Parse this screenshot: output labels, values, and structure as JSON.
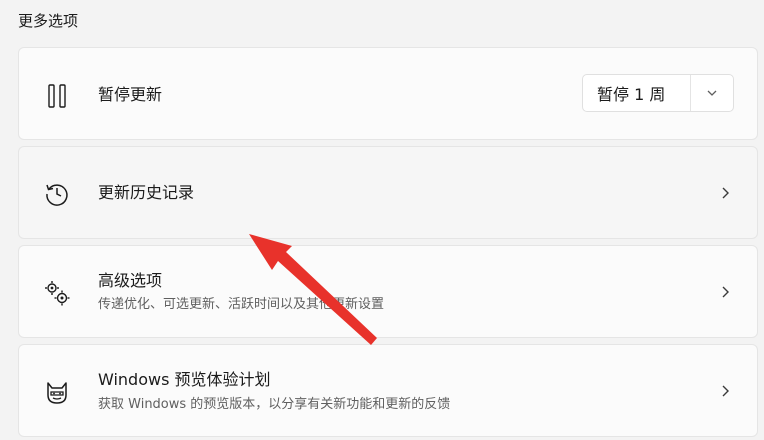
{
  "section": {
    "title": "更多选项"
  },
  "pause_updates": {
    "icon": "pause-icon",
    "label": "暂停更新",
    "select_value": "暂停 1 周",
    "dropdown_icon": "chevron-down-icon"
  },
  "update_history": {
    "icon": "history-icon",
    "label": "更新历史记录"
  },
  "advanced_options": {
    "icon": "gears-icon",
    "label": "高级选项",
    "description": "传递优化、可选更新、活跃时间以及其他更新设置"
  },
  "insider_program": {
    "icon": "ninja-cat-icon",
    "label": "Windows 预览体验计划",
    "description": "获取 Windows 的预览版本，以分享有关新功能和更新的反馈"
  },
  "colors": {
    "background": "#f3f3f3",
    "card": "#fbfbfb",
    "annotation_arrow": "#e8322b"
  }
}
